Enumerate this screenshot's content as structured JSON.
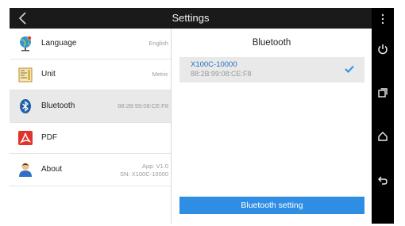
{
  "header": {
    "title": "Settings"
  },
  "menu": [
    {
      "label": "Language",
      "value": "English",
      "icon": "globe-icon"
    },
    {
      "label": "Unit",
      "value": "Metric",
      "icon": "ruler-icon"
    },
    {
      "label": "Bluetooth",
      "value": "88:2B:99:08:CE:F8",
      "icon": "bluetooth-icon",
      "selected": true
    },
    {
      "label": "PDF",
      "value": "",
      "icon": "pdf-icon"
    },
    {
      "label": "About",
      "value_line1": "App: V1.0",
      "value_line2": "SN: X100C-10000",
      "icon": "user-icon"
    }
  ],
  "bluetooth_panel": {
    "title": "Bluetooth",
    "device": {
      "name": "X100C-10000",
      "address": "88:2B:99:08:CE:F8",
      "connected_icon": "check-icon"
    },
    "setting_button": "Bluetooth setting"
  },
  "navbar": {
    "icons": [
      "menu-dots-icon",
      "power-icon",
      "recents-icon",
      "home-icon",
      "back-icon"
    ]
  },
  "colors": {
    "accent": "#2f8de4",
    "device_text": "#1f6fc0",
    "topbar": "#1a1a1a",
    "selected": "#e9e9e9"
  }
}
